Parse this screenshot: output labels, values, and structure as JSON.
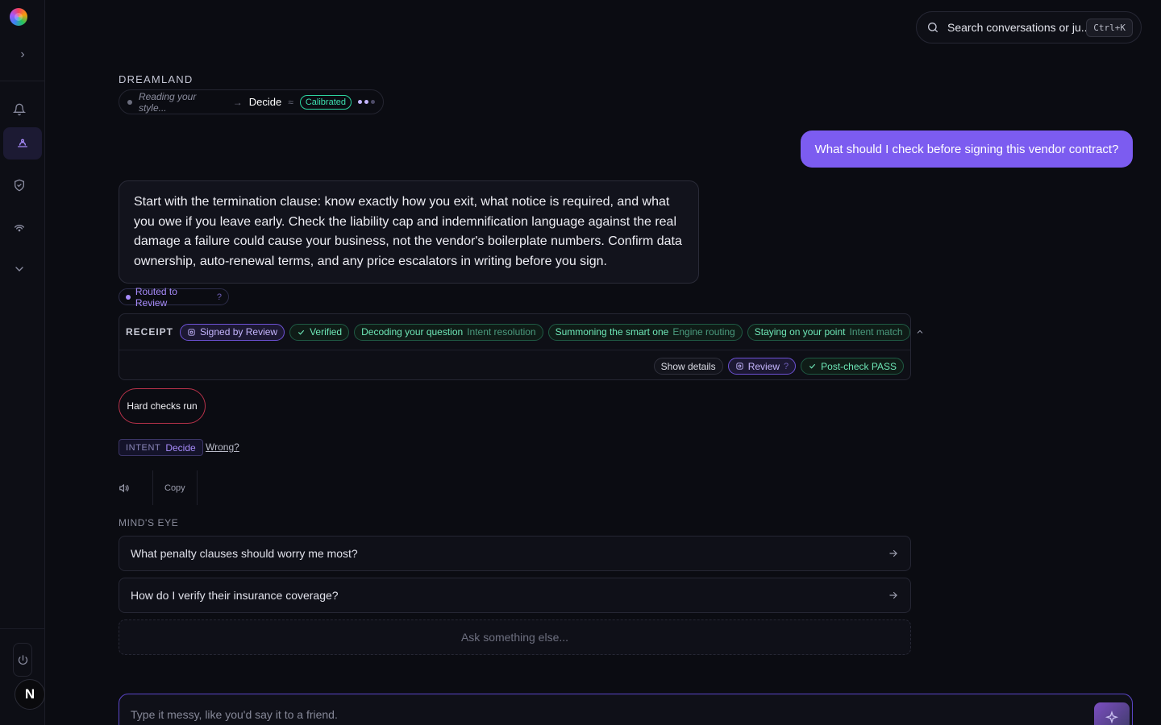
{
  "sidebar": {
    "items": [
      "bell-icon",
      "bot-icon",
      "shield-icon",
      "signal-icon",
      "chevron-down-icon"
    ],
    "avatar_letter": "N"
  },
  "search": {
    "placeholder": "Search conversations or ju...",
    "shortcut": "Ctrl+K"
  },
  "header": {
    "brand": "DREAMLAND",
    "pipeline": {
      "reading": "Reading your style...",
      "arrow": "→",
      "mode": "Decide",
      "approx": "≈",
      "badge": "Calibrated"
    }
  },
  "conversation": {
    "user_message": "What should I check before signing this vendor contract?",
    "assistant_message": "Start with the termination clause: know exactly how you exit, what notice is required, and what you owe if you leave early. Check the liability cap and indemnification language against the real damage a failure could cause your business, not the vendor's boilerplate numbers. Confirm data ownership, auto-renewal terms, and any price escalators in writing before you sign.",
    "routed": "Routed to Review",
    "routed_help": "?"
  },
  "receipt": {
    "label": "RECEIPT",
    "signed": "Signed by Review",
    "verified": "Verified",
    "steps": [
      {
        "name": "Decoding your question",
        "sub": "Intent resolution"
      },
      {
        "name": "Summoning the smart one",
        "sub": "Engine routing"
      },
      {
        "name": "Staying on your point",
        "sub": "Intent match"
      }
    ],
    "show_details": "Show details",
    "review": "Review",
    "review_help": "?",
    "postcheck": "Post-check PASS"
  },
  "hard_checks": "Hard checks run",
  "intent": {
    "key": "INTENT",
    "value": "Decide",
    "wrong": "Wrong?"
  },
  "actions": {
    "copy": "Copy"
  },
  "minds_eye": {
    "title": "MIND'S EYE",
    "suggestions": [
      "What penalty clauses should worry me most?",
      "How do I verify their insurance coverage?"
    ],
    "ask_else": "Ask something else..."
  },
  "composer": {
    "placeholder": "Type it messy, like you'd say it to a friend."
  },
  "colors": {
    "accent": "#7c5cf0",
    "success": "#2dd4a0",
    "danger": "#b8324a"
  }
}
